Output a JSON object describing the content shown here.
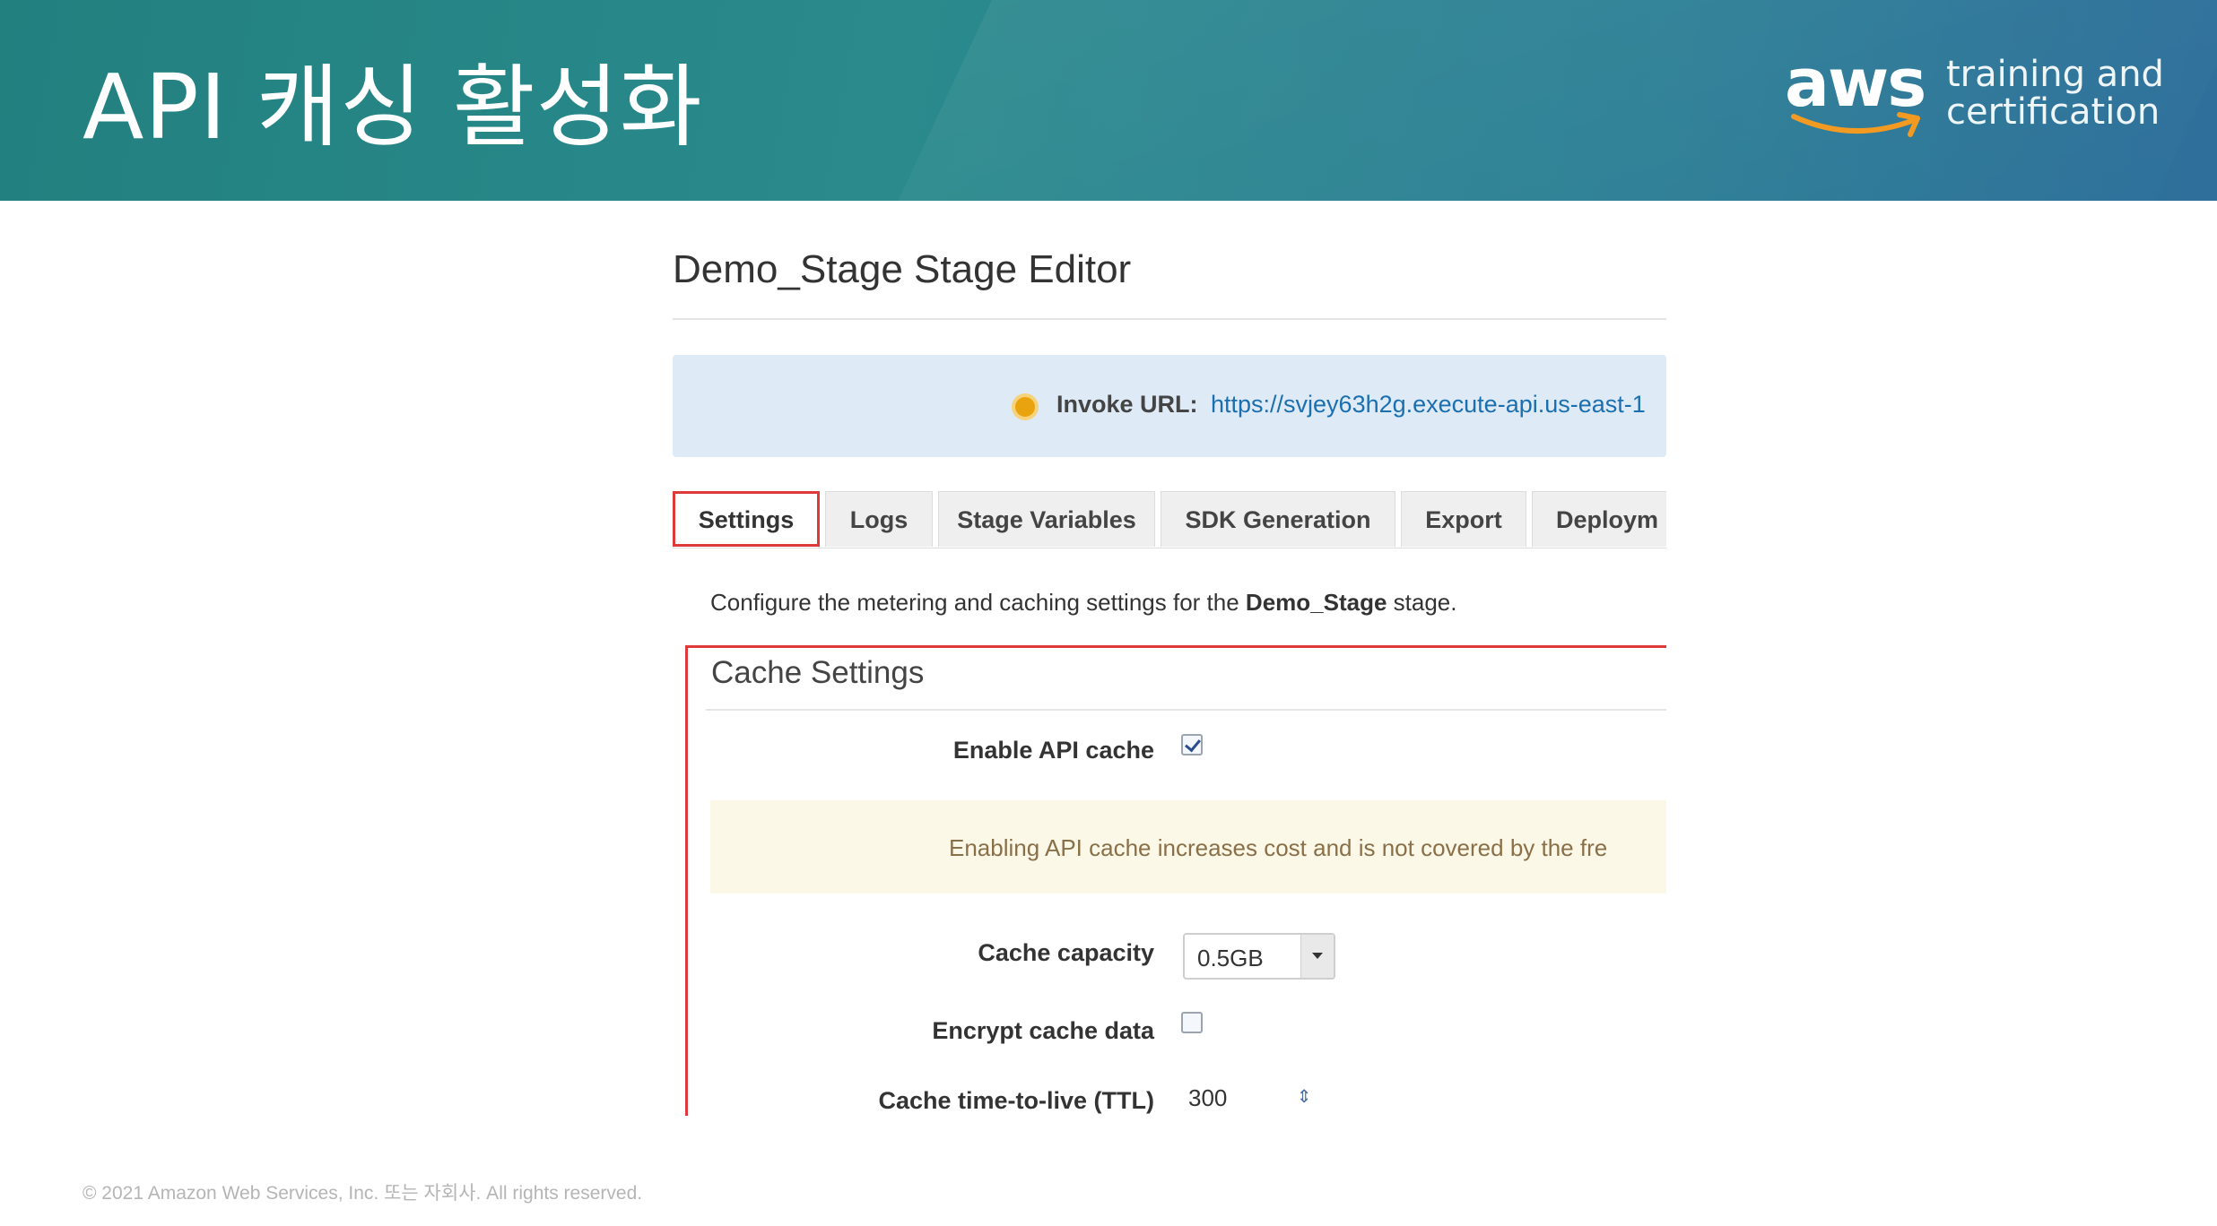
{
  "slide": {
    "title": "API 캐싱 활성화",
    "logo_word": "aws",
    "tagline_line1": "training and",
    "tagline_line2": "certification",
    "copyright": "© 2021 Amazon Web Services, Inc. 또는 자회사. All rights reserved."
  },
  "editor": {
    "title": "Demo_Stage Stage Editor",
    "invoke_label": "Invoke URL:",
    "invoke_url": "https://svjey63h2g.execute-api.us-east-1",
    "tabs": [
      {
        "label": "Settings",
        "active": true
      },
      {
        "label": "Logs"
      },
      {
        "label": "Stage Variables"
      },
      {
        "label": "SDK Generation"
      },
      {
        "label": "Export"
      },
      {
        "label": "Deploym"
      }
    ],
    "description_prefix": "Configure the metering and caching settings for the",
    "description_stage": "Demo_Stage",
    "description_suffix": "stage.",
    "cache": {
      "title": "Cache Settings",
      "enable_label": "Enable API cache",
      "enable_checked": true,
      "warning": "Enabling API cache increases cost and is not covered by the fre",
      "capacity_label": "Cache capacity",
      "capacity_value": "0.5GB",
      "encrypt_label": "Encrypt cache data",
      "encrypt_checked": false,
      "ttl_label": "Cache time-to-live (TTL)",
      "ttl_value": "300"
    }
  },
  "colors": {
    "banner": "#2a8a8c",
    "highlight": "#e0393a",
    "link": "#1a6fb0",
    "invoke_bg": "#deeaf5",
    "warn_bg": "#fcf8e8"
  }
}
